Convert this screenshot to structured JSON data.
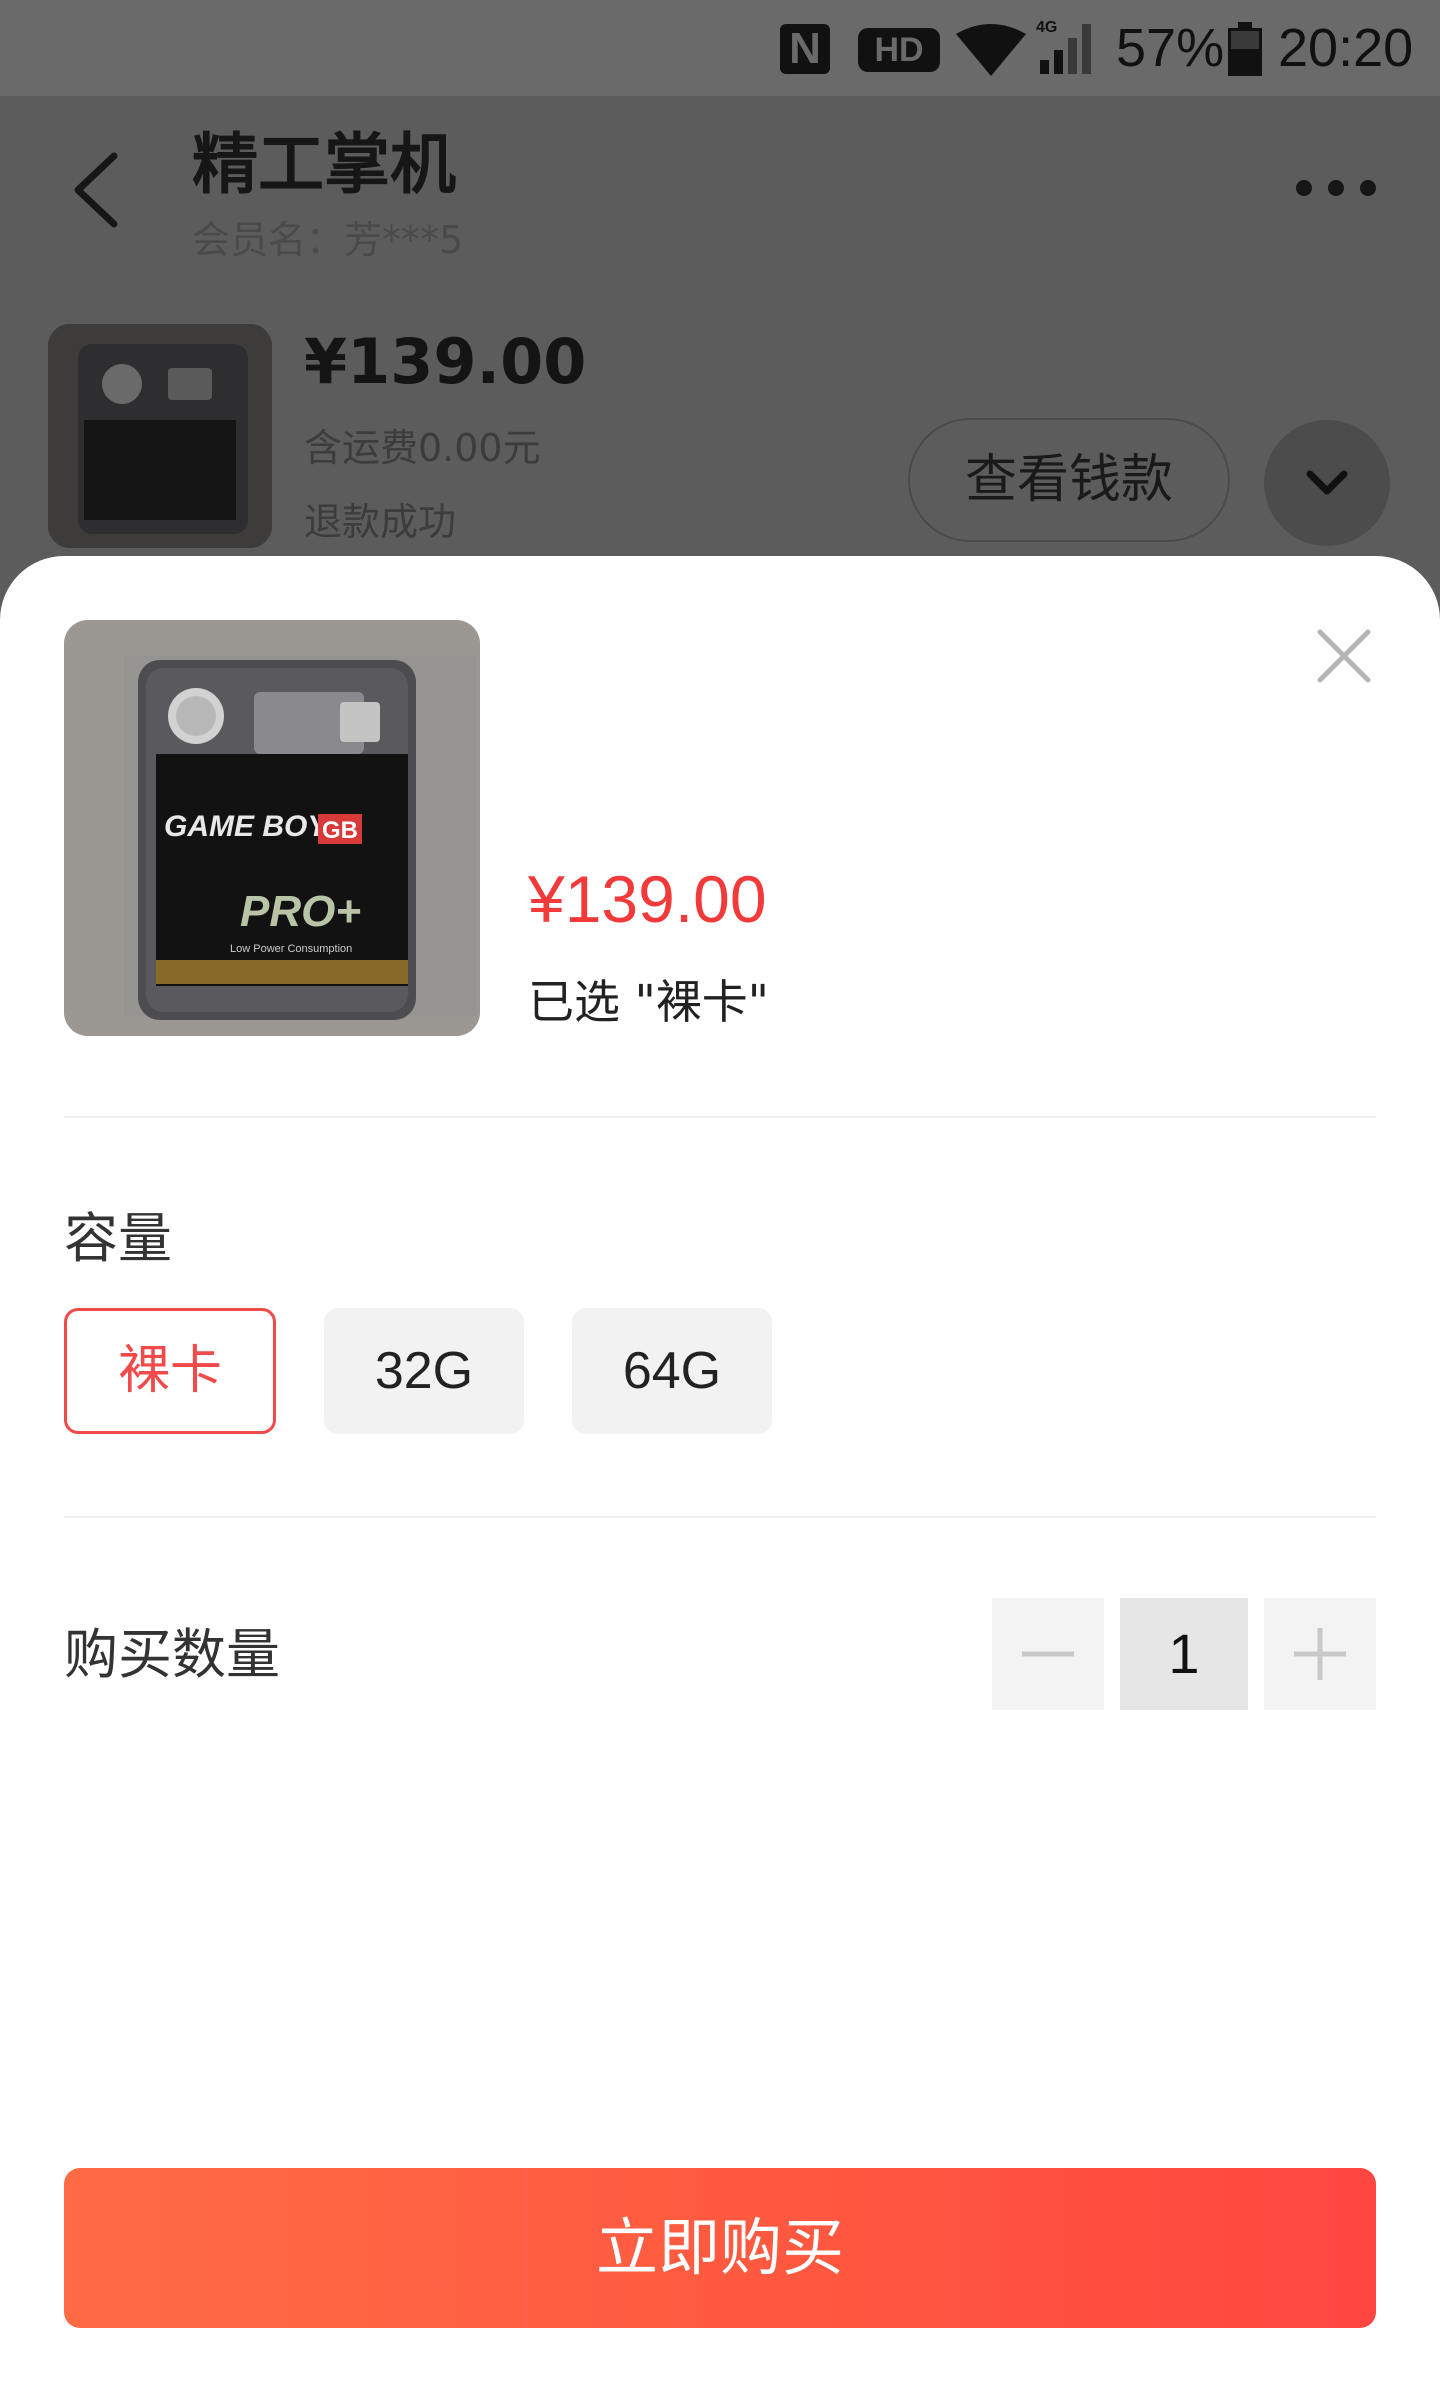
{
  "status_bar": {
    "hd_label": "HD",
    "network_label": "4G",
    "battery_percent": "57%",
    "time": "20:20",
    "icons": [
      "nfc-icon",
      "hd-icon",
      "wifi-icon",
      "signal-icon",
      "battery-icon"
    ]
  },
  "background_page": {
    "shop_title": "精工掌机",
    "member_name": "会员名：芳***5",
    "order": {
      "price": "¥139.00",
      "shipping": "含运费0.00元",
      "status": "退款成功",
      "view_button_label": "查看钱款"
    },
    "icons": [
      "back-arrow-icon",
      "more-dots-icon",
      "chevron-down-icon"
    ]
  },
  "sheet": {
    "product_image_text": {
      "brand": "GAME BOY",
      "badge": "GB",
      "model": "PRO+",
      "tagline": "Low Power Consumption"
    },
    "price": "¥139.00",
    "selected_text": "已选 \"裸卡\"",
    "capacity_label": "容量",
    "capacity_options": [
      {
        "label": "裸卡",
        "selected": true
      },
      {
        "label": "32G",
        "selected": false
      },
      {
        "label": "64G",
        "selected": false
      }
    ],
    "quantity_label": "购买数量",
    "quantity_value": "1",
    "buy_button_label": "立即购买",
    "icons": [
      "close-icon",
      "minus-icon",
      "plus-icon"
    ]
  },
  "colors": {
    "accent_red": "#f23a3a",
    "buy_gradient_start": "#ff6b45",
    "buy_gradient_end": "#ff4640",
    "overlay_dim": "#5c5c5c"
  }
}
